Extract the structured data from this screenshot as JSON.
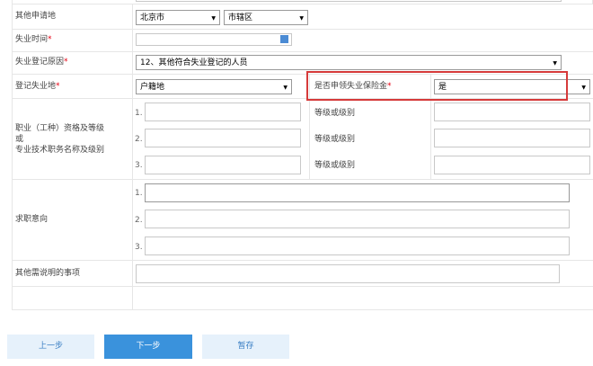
{
  "form": {
    "apply_place": {
      "label": "其他申请地",
      "city": "北京市",
      "district": "市辖区"
    },
    "unemploy_time": {
      "label": "失业时间",
      "required_mark": "*",
      "value": ""
    },
    "unemploy_reason": {
      "label": "失业登记原因",
      "required_mark": "*",
      "value": "12、其他符合失业登记的人员"
    },
    "unemploy_place": {
      "label": "登记失业地",
      "required_mark": "*",
      "value": "户籍地"
    },
    "insurance": {
      "label": "是否申领失业保险金",
      "required_mark": "*",
      "value": "是"
    },
    "qualification": {
      "label_line1": "职业（工种）资格及等级",
      "label_line2": "或",
      "label_line3": "专业技术职务名称及级别",
      "rows": [
        {
          "num": "1.",
          "grade_label": "等级或级别"
        },
        {
          "num": "2.",
          "grade_label": "等级或级别"
        },
        {
          "num": "3.",
          "grade_label": "等级或级别"
        }
      ]
    },
    "job_intent": {
      "label": "求职意向",
      "nums": [
        "1.",
        "2.",
        "3."
      ]
    },
    "other_notes": {
      "label": "其他需说明的事项",
      "value": ""
    }
  },
  "buttons": {
    "prev": "上一步",
    "next": "下一步",
    "save": "暂存"
  },
  "colors": {
    "required": "#e60012",
    "highlight": "#d63a3a",
    "primary": "#3a92dc",
    "light": "#e6f1fb"
  }
}
